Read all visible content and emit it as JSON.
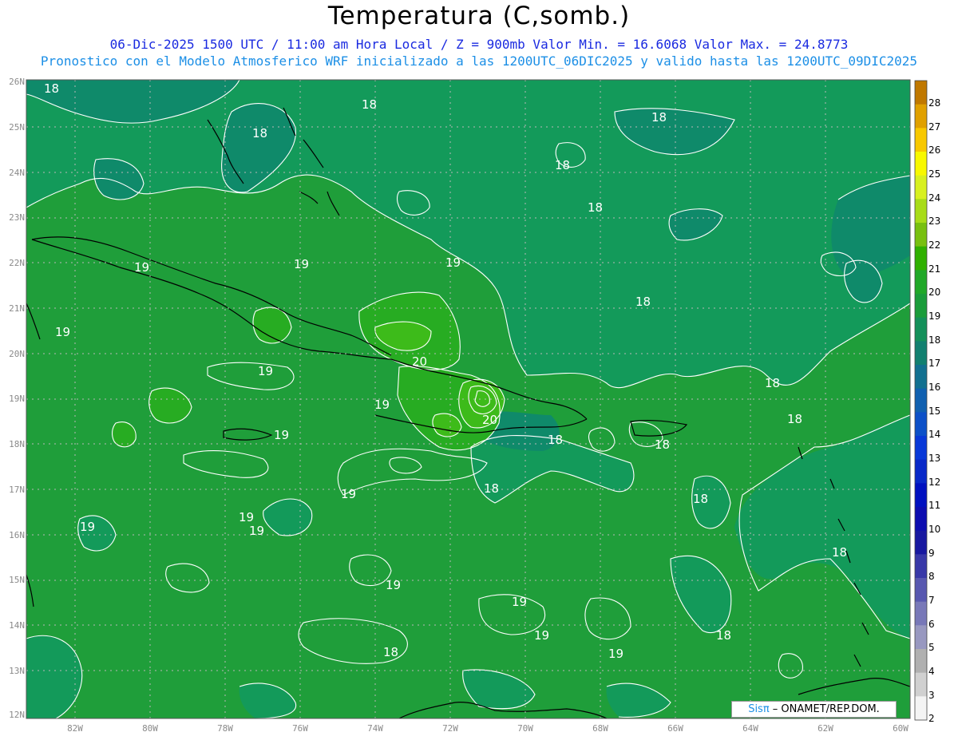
{
  "title": "Temperatura (C,somb.)",
  "subtitle_line1": "06-Dic-2025  1500 UTC / 11:00 am Hora Local / Z = 900mb   Valor Min. = 16.6068  Valor Max. = 24.8773",
  "subtitle_line2": "Pronostico con el Modelo Atmosferico WRF inicializado a las 1200UTC_06DIC2025 y valido hasta las  1200UTC_09DIC2025",
  "colors": {
    "field_base": "#1f9e3a",
    "field_18": "#139a5a",
    "field_17": "#0f8a6a",
    "field_16": "#157a7a",
    "field_20": "#27ac22",
    "field_21": "#3dbb1a",
    "contour": "#ffffff",
    "coast": "#000000",
    "grid": "#b8b8b8"
  },
  "lat_labels": [
    "26N",
    "25N",
    "24N",
    "23N",
    "22N",
    "21N",
    "20N",
    "19N",
    "18N",
    "17N",
    "16N",
    "15N",
    "14N",
    "13N",
    "12N"
  ],
  "lon_labels": [
    "82W",
    "80W",
    "78W",
    "76W",
    "74W",
    "72W",
    "70W",
    "68W",
    "66W",
    "64W",
    "62W",
    "60W"
  ],
  "legend": {
    "levels": [
      28,
      27,
      26,
      25,
      24,
      23,
      22,
      21,
      20,
      19,
      18,
      17,
      16,
      15,
      14,
      13,
      12,
      11,
      10,
      9,
      8,
      7,
      6,
      5,
      4,
      3,
      2
    ],
    "colors": [
      "#c07800",
      "#e0a000",
      "#f8c800",
      "#f8f800",
      "#d8f020",
      "#a8dc18",
      "#78c010",
      "#30b000",
      "#20a828",
      "#1a9c3a",
      "#14905a",
      "#128070",
      "#127090",
      "#1060b0",
      "#0c50c8",
      "#0838d8",
      "#0828c8",
      "#0010c0",
      "#0c0cb0",
      "#1818a0",
      "#3838a8",
      "#5858b0",
      "#7878b8",
      "#9898c0",
      "#b0b0b0",
      "#d0d0d0",
      "#f4f4f4"
    ]
  },
  "contour_labels": [
    "18",
    "18",
    "18",
    "18",
    "18",
    "18",
    "18",
    "18",
    "18",
    "18",
    "18",
    "18",
    "18",
    "18",
    "18",
    "19",
    "19",
    "19",
    "19",
    "19",
    "19",
    "19",
    "19",
    "19",
    "19",
    "19",
    "19",
    "19",
    "19",
    "20",
    "20"
  ],
  "credit": {
    "brand": "Sisπ",
    "text": " – ONAMET/REP.DOM."
  }
}
